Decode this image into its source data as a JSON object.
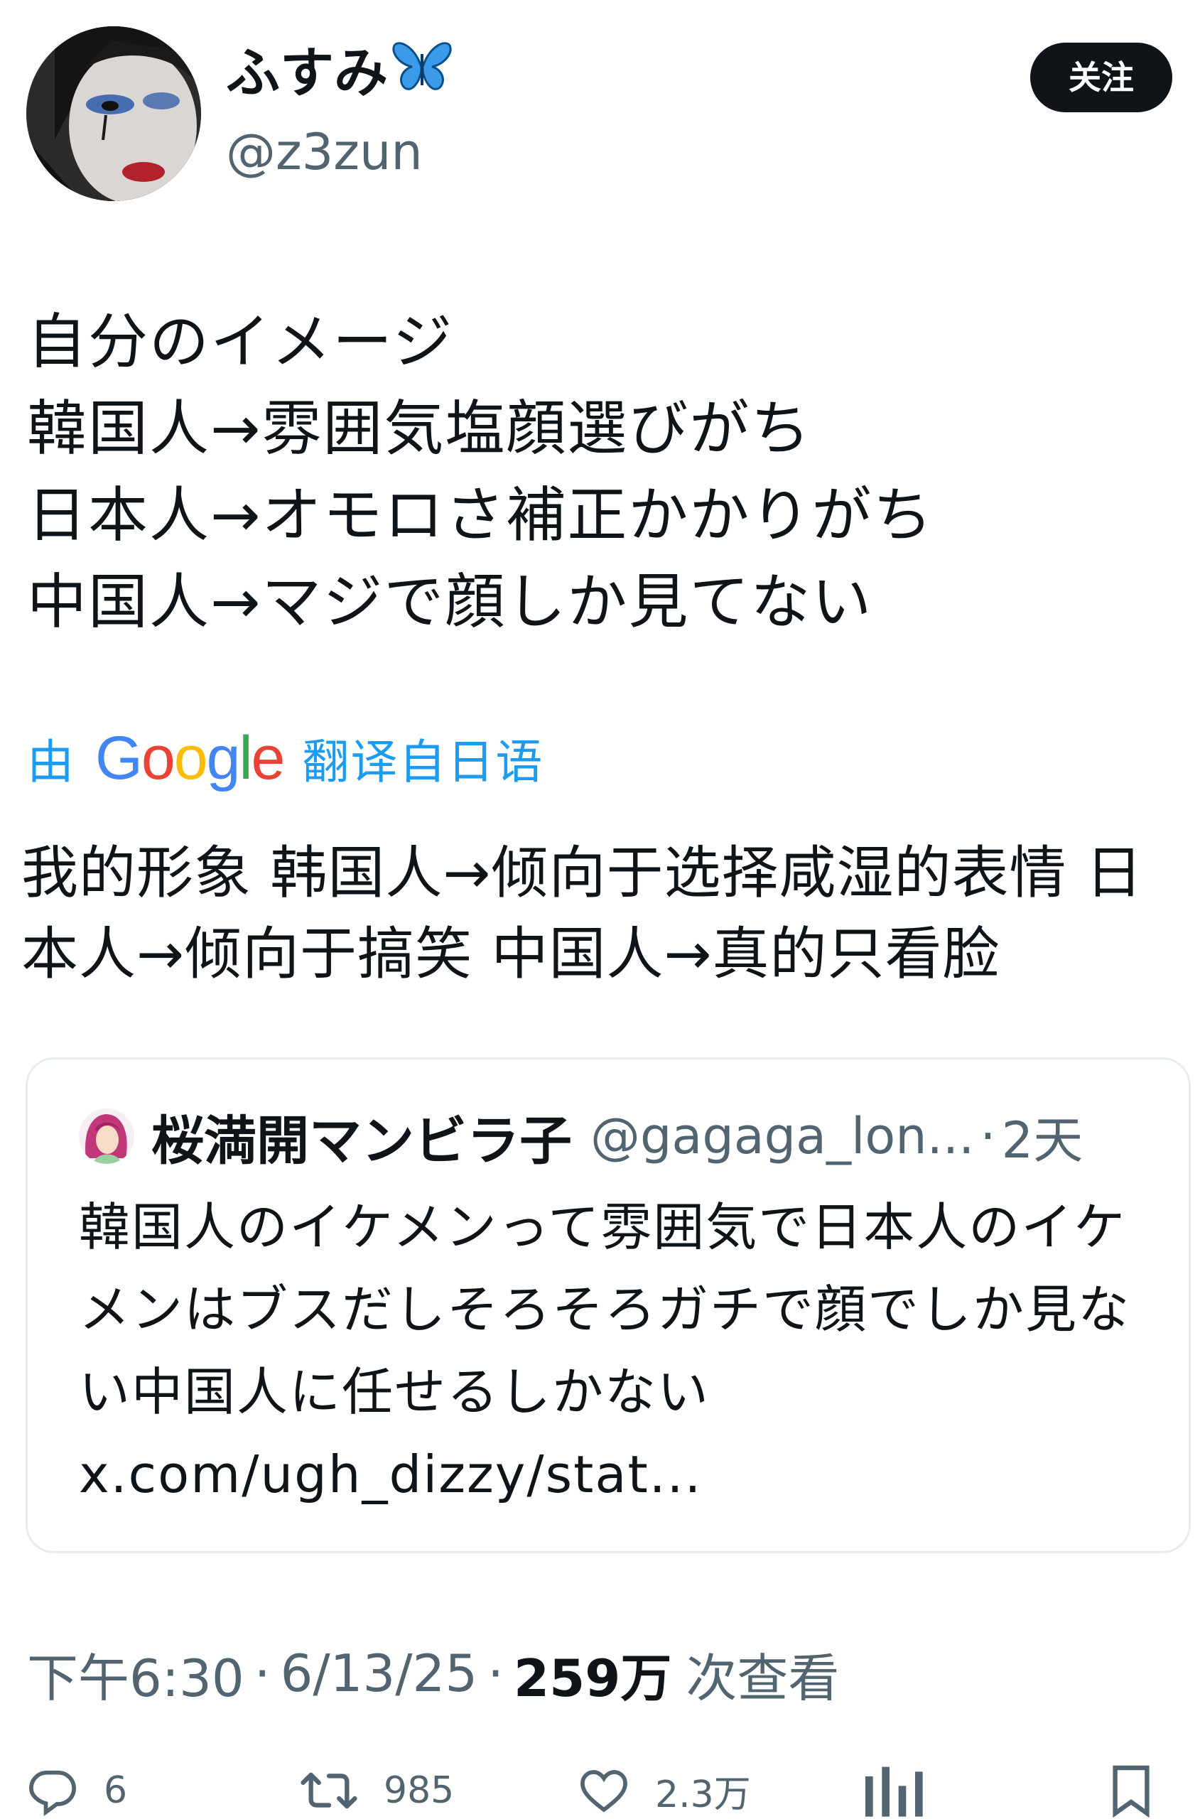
{
  "author": {
    "display_name": "ふすみ",
    "handle": "@z3zun",
    "follow_label": "关注"
  },
  "tweet": {
    "lines": [
      "自分のイメージ",
      "韓国人→雰囲気塩顔選びがち",
      "日本人→オモロさ補正かかりがち",
      "中国人→マジで顔しか見てない"
    ]
  },
  "translation": {
    "prefix": "由",
    "logo_text": "Google",
    "suffix": "翻译自日语",
    "text": "我的形象 韩国人→倾向于选择咸湿的表情 日本人→倾向于搞笑 中国人→真的只看脸"
  },
  "quote": {
    "name": "桜満開マンビラ子",
    "handle": "@gagaga_lon...",
    "separator": "·",
    "time": "2天",
    "text": "韓国人のイケメンって雰囲気で日本人のイケメンはブスだしそろそろガチで顔でしか見ない中国人に任せるしかない ",
    "link": "x.com/ugh_dizzy/stat..."
  },
  "meta": {
    "time": "下午6:30",
    "date": "6/13/25",
    "separator": "·",
    "views_count": "259万",
    "views_label": "次查看"
  },
  "actions": {
    "replies": "6",
    "retweets": "985",
    "likes": "2.3万"
  },
  "colors": {
    "text": "#0f1419",
    "secondary": "#536471",
    "link_blue": "#1d9bf0",
    "border": "#e6ecf0",
    "butterfly": "#3b9be8"
  },
  "icons": {
    "verified_emoji": "butterfly-icon",
    "reply": "reply-icon",
    "retweet": "retweet-icon",
    "like": "heart-icon",
    "views": "views-icon",
    "bookmark": "bookmark-icon"
  }
}
